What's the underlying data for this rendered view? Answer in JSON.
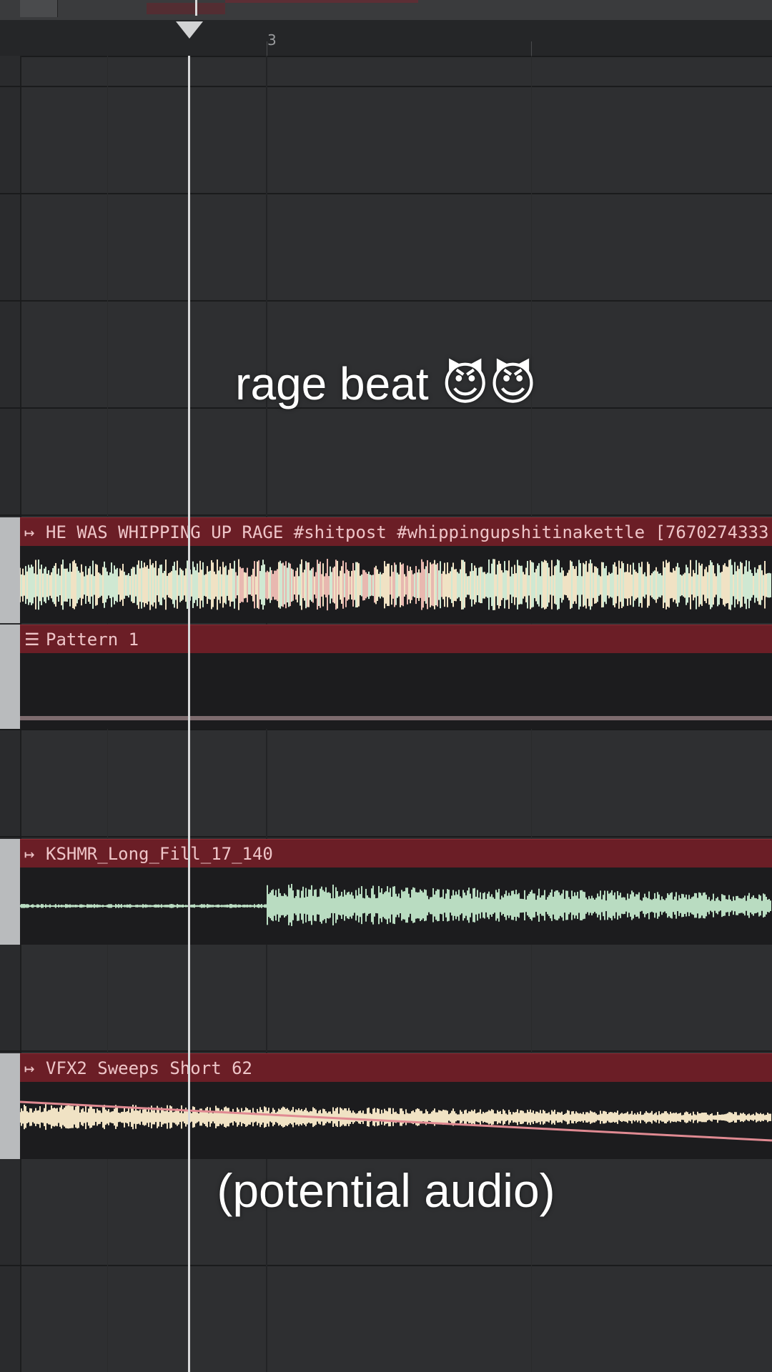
{
  "ruler": {
    "bar_number": "3"
  },
  "clips": [
    {
      "label": "HE WAS WHIPPING UP RAGE #shitpost #whippingupshitinakettle [7670274333",
      "type": "audio",
      "icon": "audio-clip-arrow-icon"
    },
    {
      "label": "Pattern 1",
      "type": "pattern",
      "icon": "pattern-icon"
    },
    {
      "label": "KSHMR_Long_Fill_17_140",
      "type": "audio",
      "icon": "audio-clip-arrow-icon"
    },
    {
      "label": "VFX2 Sweeps Short 62",
      "type": "audio",
      "icon": "audio-clip-arrow-icon"
    }
  ],
  "captions": {
    "top": "rage beat 😈😈",
    "bottom": "(potential audio)"
  },
  "colors": {
    "clip_header": "#6b1e26",
    "waveform_green": "#cfe8d2",
    "waveform_cream": "#f0e2c4",
    "playhead": "#d8d9da"
  }
}
